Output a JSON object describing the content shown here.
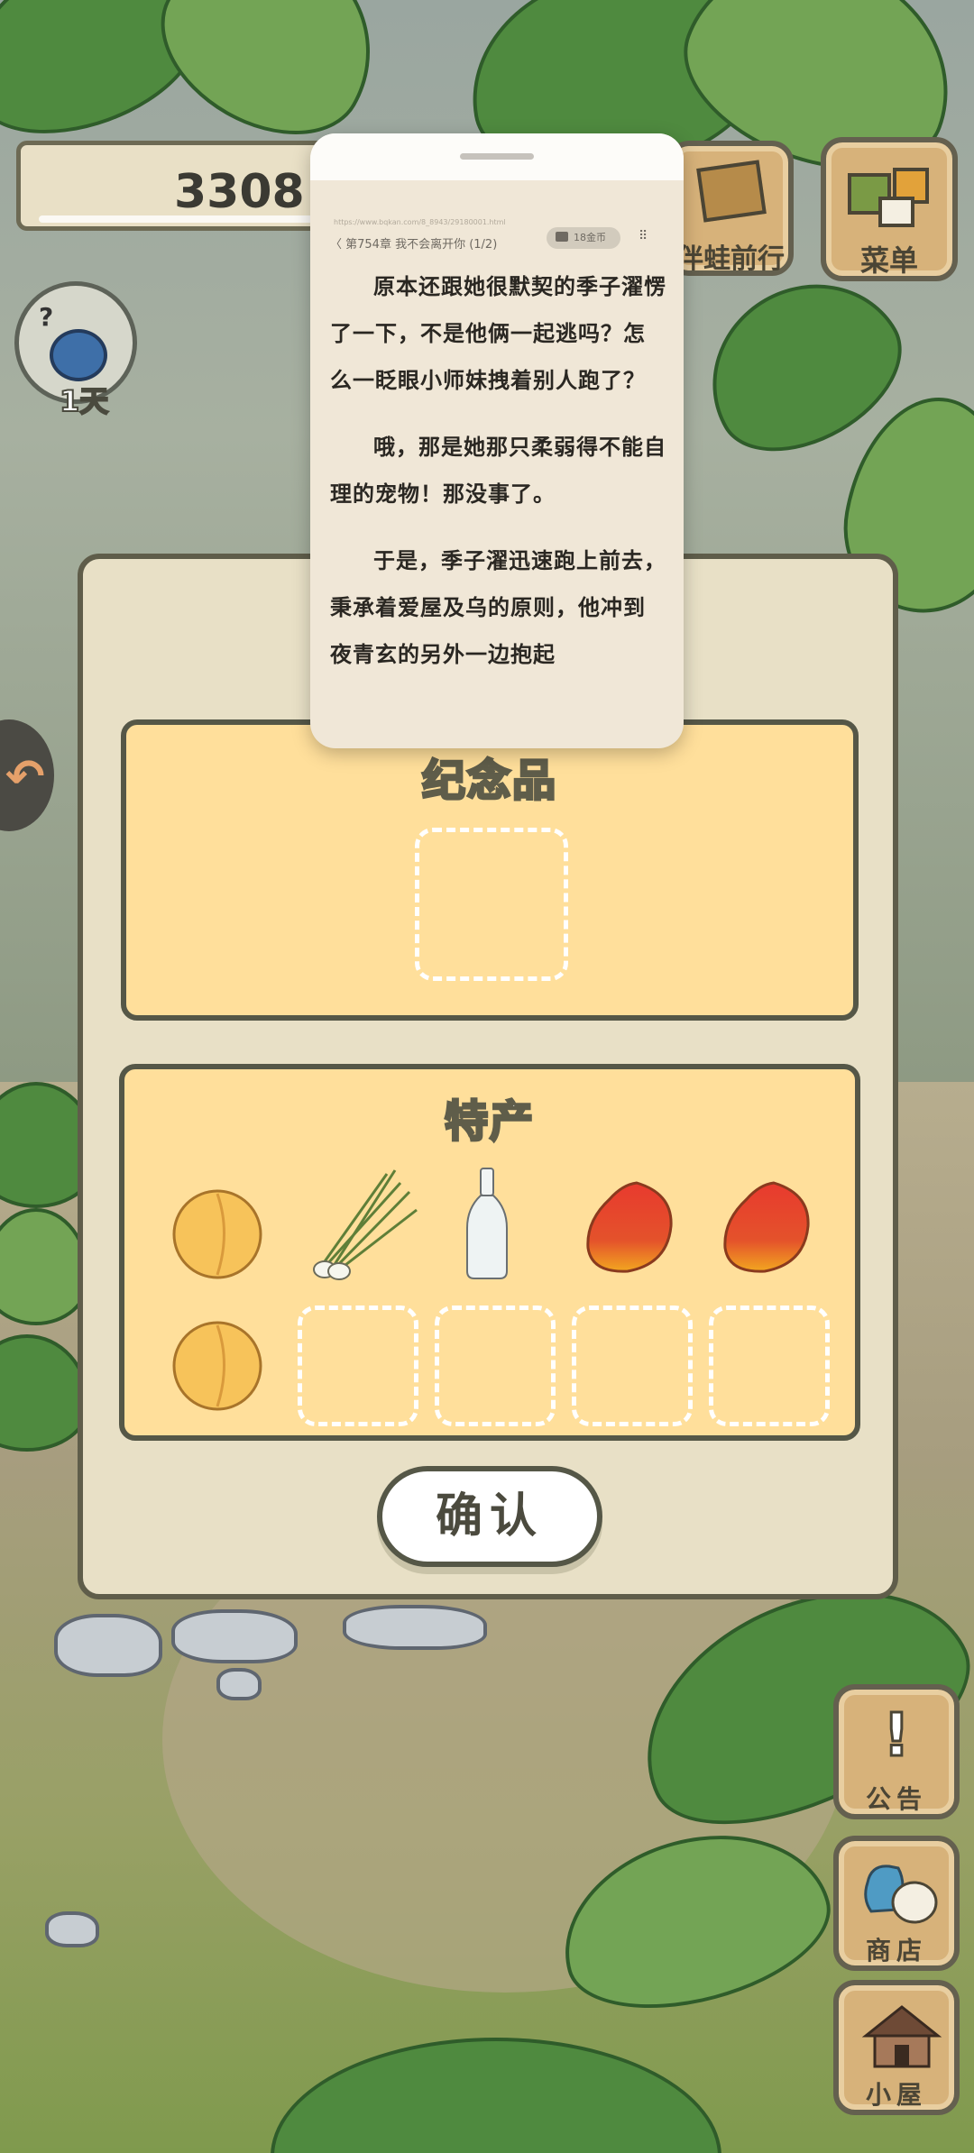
{
  "hud": {
    "coins": "3308",
    "days": "1天",
    "travel_label": "伴蛙前行",
    "menu_label": "菜单"
  },
  "modal": {
    "souvenir_title": "纪念品",
    "specialty_title": "特产",
    "confirm_label": "确认",
    "specialty_items": [
      {
        "icon": "peach-icon"
      },
      {
        "icon": "green-onion-icon"
      },
      {
        "icon": "glass-bottle-icon"
      },
      {
        "icon": "mango-icon"
      },
      {
        "icon": "mango-icon"
      },
      {
        "icon": "peach-icon"
      }
    ]
  },
  "side_buttons": {
    "notice_label": "公告",
    "shop_label": "商店",
    "house_label": "小屋"
  },
  "reader": {
    "url": "https://www.bqkan.com/8_8943/29180001.html",
    "chapter": "〈 第754章 我不会离开你 (1/2)",
    "coin_label": "18金币",
    "paragraphs": [
      "原本还跟她很默契的季子濯愣了一下，不是他俩一起逃吗？怎么一眨眼小师妹拽着别人跑了？",
      "哦，那是她那只柔弱得不能自理的宠物！那没事了。",
      "于是，季子濯迅速跑上前去，秉承着爱屋及乌的原则，他冲到夜青玄的另外一边抱起"
    ]
  },
  "colors": {
    "panel_fill": "#ffdf9b",
    "modal_fill": "#e8e0c6",
    "button_wood": "#d7b27a",
    "reader_bg": "#f0e7d7"
  }
}
